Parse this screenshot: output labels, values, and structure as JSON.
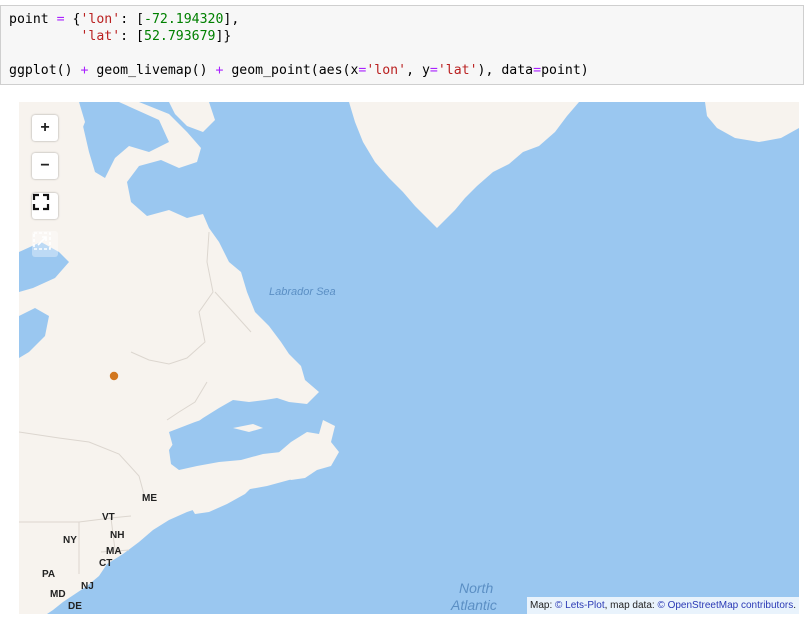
{
  "code": {
    "line1": {
      "var": "point",
      "eq": " = ",
      "open": "{",
      "key": "'lon'",
      "colon": ": [",
      "val": "-72.194320",
      "close": "],"
    },
    "line2": {
      "indent": "         ",
      "key": "'lat'",
      "colon": ": [",
      "val": "52.793679",
      "close": "]}"
    },
    "line3": {
      "p1": "ggplot() ",
      "plus1": "+",
      "p2": " geom_livemap() ",
      "plus2": "+",
      "p3": " geom_point(aes(x",
      "eq1": "=",
      "s1": "'lon'",
      "p4": ", y",
      "eq2": "=",
      "s2": "'lat'",
      "p5": "), data",
      "eq3": "=",
      "p6": "point)"
    }
  },
  "map": {
    "controls": {
      "zoom_in": "+",
      "zoom_out": "−"
    },
    "sea_labels": {
      "labrador": "Labrador Sea",
      "north": "North",
      "atlantic": "Atlantic"
    },
    "states": [
      "ME",
      "VT",
      "NY",
      "NH",
      "MA",
      "CT",
      "PA",
      "NJ",
      "MD",
      "DE"
    ],
    "point": {
      "lon": -72.19432,
      "lat": 52.793679,
      "color": "#d2771f"
    },
    "colors": {
      "water": "#9ac7f0",
      "land": "#f7f3ee",
      "border": "#dcd6cf"
    },
    "attribution": {
      "prefix": "Map: ",
      "c1": "©",
      "letsplot": " Lets-Plot",
      "mid": ", map data: ",
      "c2": "©",
      "osm": " OpenStreetMap contributors",
      "suffix": "."
    }
  }
}
